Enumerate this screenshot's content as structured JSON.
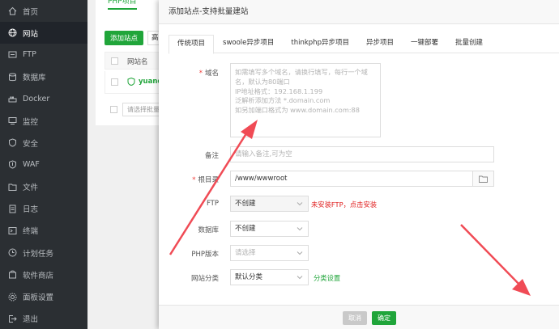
{
  "sidebar": {
    "items": [
      {
        "label": "首页",
        "icon": "home-icon"
      },
      {
        "label": "网站",
        "icon": "globe-icon"
      },
      {
        "label": "FTP",
        "icon": "ftp-icon"
      },
      {
        "label": "数据库",
        "icon": "database-icon"
      },
      {
        "label": "Docker",
        "icon": "docker-icon"
      },
      {
        "label": "监控",
        "icon": "monitor-icon"
      },
      {
        "label": "安全",
        "icon": "shield-icon"
      },
      {
        "label": "WAF",
        "icon": "waf-icon"
      },
      {
        "label": "文件",
        "icon": "folder-icon"
      },
      {
        "label": "日志",
        "icon": "log-icon"
      },
      {
        "label": "终端",
        "icon": "terminal-icon"
      },
      {
        "label": "计划任务",
        "icon": "clock-icon"
      },
      {
        "label": "软件商店",
        "icon": "store-icon"
      },
      {
        "label": "面板设置",
        "icon": "settings-icon"
      },
      {
        "label": "退出",
        "icon": "logout-icon"
      }
    ],
    "active_index": 1
  },
  "background": {
    "tab": "PHP项目",
    "add_button": "添加站点",
    "second_button": "高",
    "header_label": "网站名",
    "row_name": "yuanqi",
    "batch_placeholder": "请选择批量"
  },
  "modal": {
    "title": "添加站点-支持批量建站",
    "tabs": [
      "传统项目",
      "swoole异步项目",
      "thinkphp异步项目",
      "异步项目",
      "一键部署",
      "批量创建"
    ],
    "active_tab": 0,
    "domain": {
      "label": "域名",
      "placeholder_lines": [
        "如需填写多个域名，请换行填写，每行一个域名，默认为80端口",
        "IP地址格式：192.168.1.199",
        "泛解析添加方法 *.domain.com",
        "如另加端口格式为 www.domain.com:88"
      ]
    },
    "remark": {
      "label": "备注",
      "placeholder": "请输入备注,可为空"
    },
    "root_dir": {
      "label": "根目录",
      "value": "/www/wwwroot"
    },
    "ftp": {
      "label": "FTP",
      "value": "不创建",
      "hint": "未安装FTP，点击安装"
    },
    "database": {
      "label": "数据库",
      "value": "不创建"
    },
    "php_version": {
      "label": "PHP版本",
      "placeholder": "请选择"
    },
    "site_category": {
      "label": "网站分类",
      "value": "默认分类",
      "hint": "分类设置"
    },
    "buttons": {
      "cancel": "取消",
      "confirm": "确定"
    }
  },
  "colors": {
    "accent": "#20a53a",
    "warning": "#e02020",
    "arrow": "#f04b55",
    "sidebar_bg": "#2b2f33"
  }
}
